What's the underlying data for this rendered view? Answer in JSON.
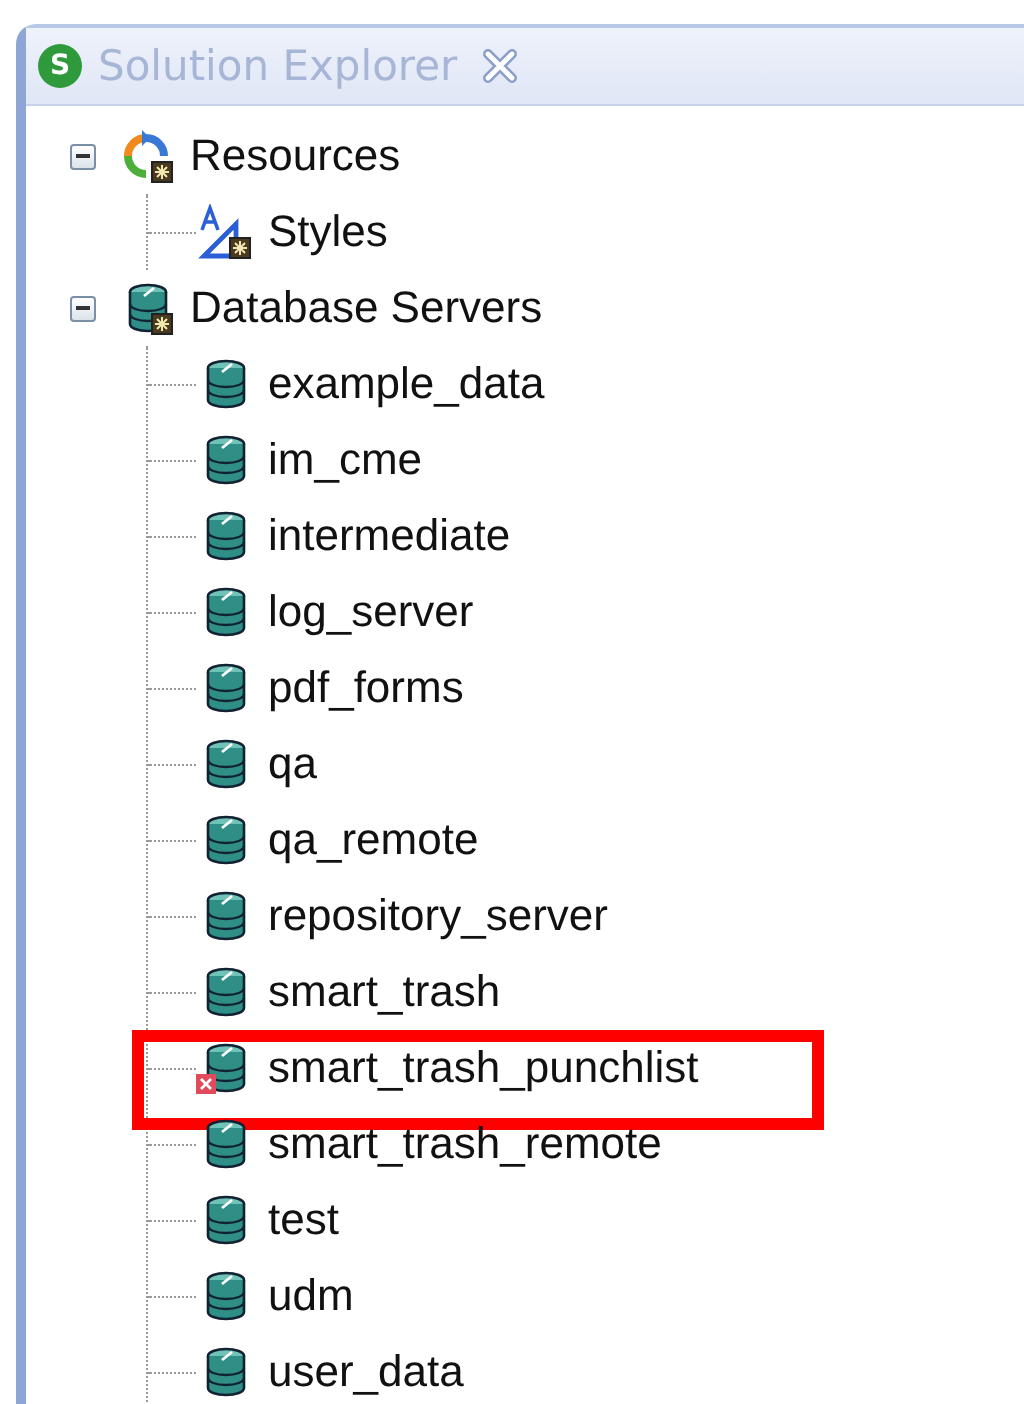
{
  "panel": {
    "title": "Solution Explorer",
    "logo_letter": "S"
  },
  "tree": [
    {
      "label": "Resources",
      "kind": "resources",
      "expanded": true,
      "children": [
        {
          "label": "Styles",
          "kind": "styles"
        }
      ]
    },
    {
      "label": "Database Servers",
      "kind": "servers",
      "expanded": true,
      "children": [
        {
          "label": "example_data",
          "kind": "database",
          "error": false,
          "highlighted": false
        },
        {
          "label": "im_cme",
          "kind": "database",
          "error": false,
          "highlighted": false
        },
        {
          "label": "intermediate",
          "kind": "database",
          "error": false,
          "highlighted": false
        },
        {
          "label": "log_server",
          "kind": "database",
          "error": false,
          "highlighted": false
        },
        {
          "label": "pdf_forms",
          "kind": "database",
          "error": false,
          "highlighted": false
        },
        {
          "label": "qa",
          "kind": "database",
          "error": false,
          "highlighted": false
        },
        {
          "label": "qa_remote",
          "kind": "database",
          "error": false,
          "highlighted": false
        },
        {
          "label": "repository_server",
          "kind": "database",
          "error": false,
          "highlighted": false
        },
        {
          "label": "smart_trash",
          "kind": "database",
          "error": false,
          "highlighted": false
        },
        {
          "label": "smart_trash_punchlist",
          "kind": "database",
          "error": true,
          "highlighted": true
        },
        {
          "label": "smart_trash_remote",
          "kind": "database",
          "error": false,
          "highlighted": false
        },
        {
          "label": "test",
          "kind": "database",
          "error": false,
          "highlighted": false
        },
        {
          "label": "udm",
          "kind": "database",
          "error": false,
          "highlighted": false
        },
        {
          "label": "user_data",
          "kind": "database",
          "error": false,
          "highlighted": false
        }
      ]
    }
  ]
}
